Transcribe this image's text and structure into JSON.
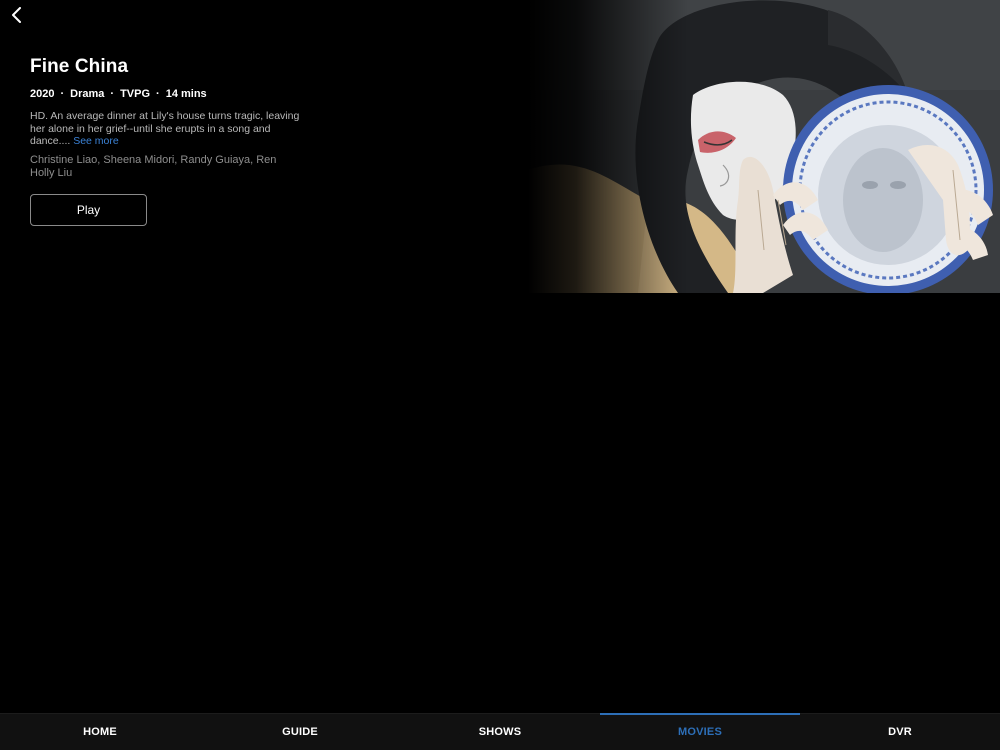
{
  "nav": {
    "back_icon": "chevron-left-icon"
  },
  "program": {
    "title": "Fine China",
    "year": "2020",
    "genre": "Drama",
    "rating": "TVPG",
    "duration": "14 mins",
    "separator": "·",
    "description": "HD. An average dinner at Lily's house turns tragic, leaving her alone in her grief--until she erupts in a song and dance....",
    "see_more_label": "See more",
    "cast": "Christine Liao, Sheena Midori, Randy Guiaya, Ren Holly Liu",
    "play_label": "Play"
  },
  "colors": {
    "accent": "#2d6fb8",
    "link": "#3b82d6",
    "background": "#000000"
  },
  "tabs": [
    {
      "label": "HOME",
      "active": false
    },
    {
      "label": "GUIDE",
      "active": false
    },
    {
      "label": "SHOWS",
      "active": false
    },
    {
      "label": "MOVIES",
      "active": true
    },
    {
      "label": "DVR",
      "active": false
    }
  ]
}
